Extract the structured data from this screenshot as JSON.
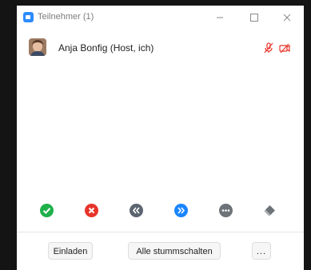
{
  "window": {
    "title": "Teilnehmer (1)",
    "controls": [
      "minimize",
      "maximize",
      "close"
    ]
  },
  "participants": [
    {
      "name": "Anja Bonfig (Host, ich)",
      "mic_state": "muted",
      "video_state": "off"
    }
  ],
  "reactions": [
    {
      "name": "yes-icon",
      "color": "#20b04a"
    },
    {
      "name": "no-icon",
      "color": "#e8342b"
    },
    {
      "name": "go-slower-icon",
      "color": "#5b6470"
    },
    {
      "name": "go-faster-icon",
      "color": "#1a85ff"
    },
    {
      "name": "more-icon",
      "color": "#6d7378"
    },
    {
      "name": "clear-all-icon",
      "color": "#6d7378"
    }
  ],
  "footer": {
    "invite_label": "Einladen",
    "mute_all_label": "Alle stummschalten",
    "more_label": "..."
  },
  "colors": {
    "accent": "#2d8cff",
    "muted_status": "#e8342b"
  }
}
